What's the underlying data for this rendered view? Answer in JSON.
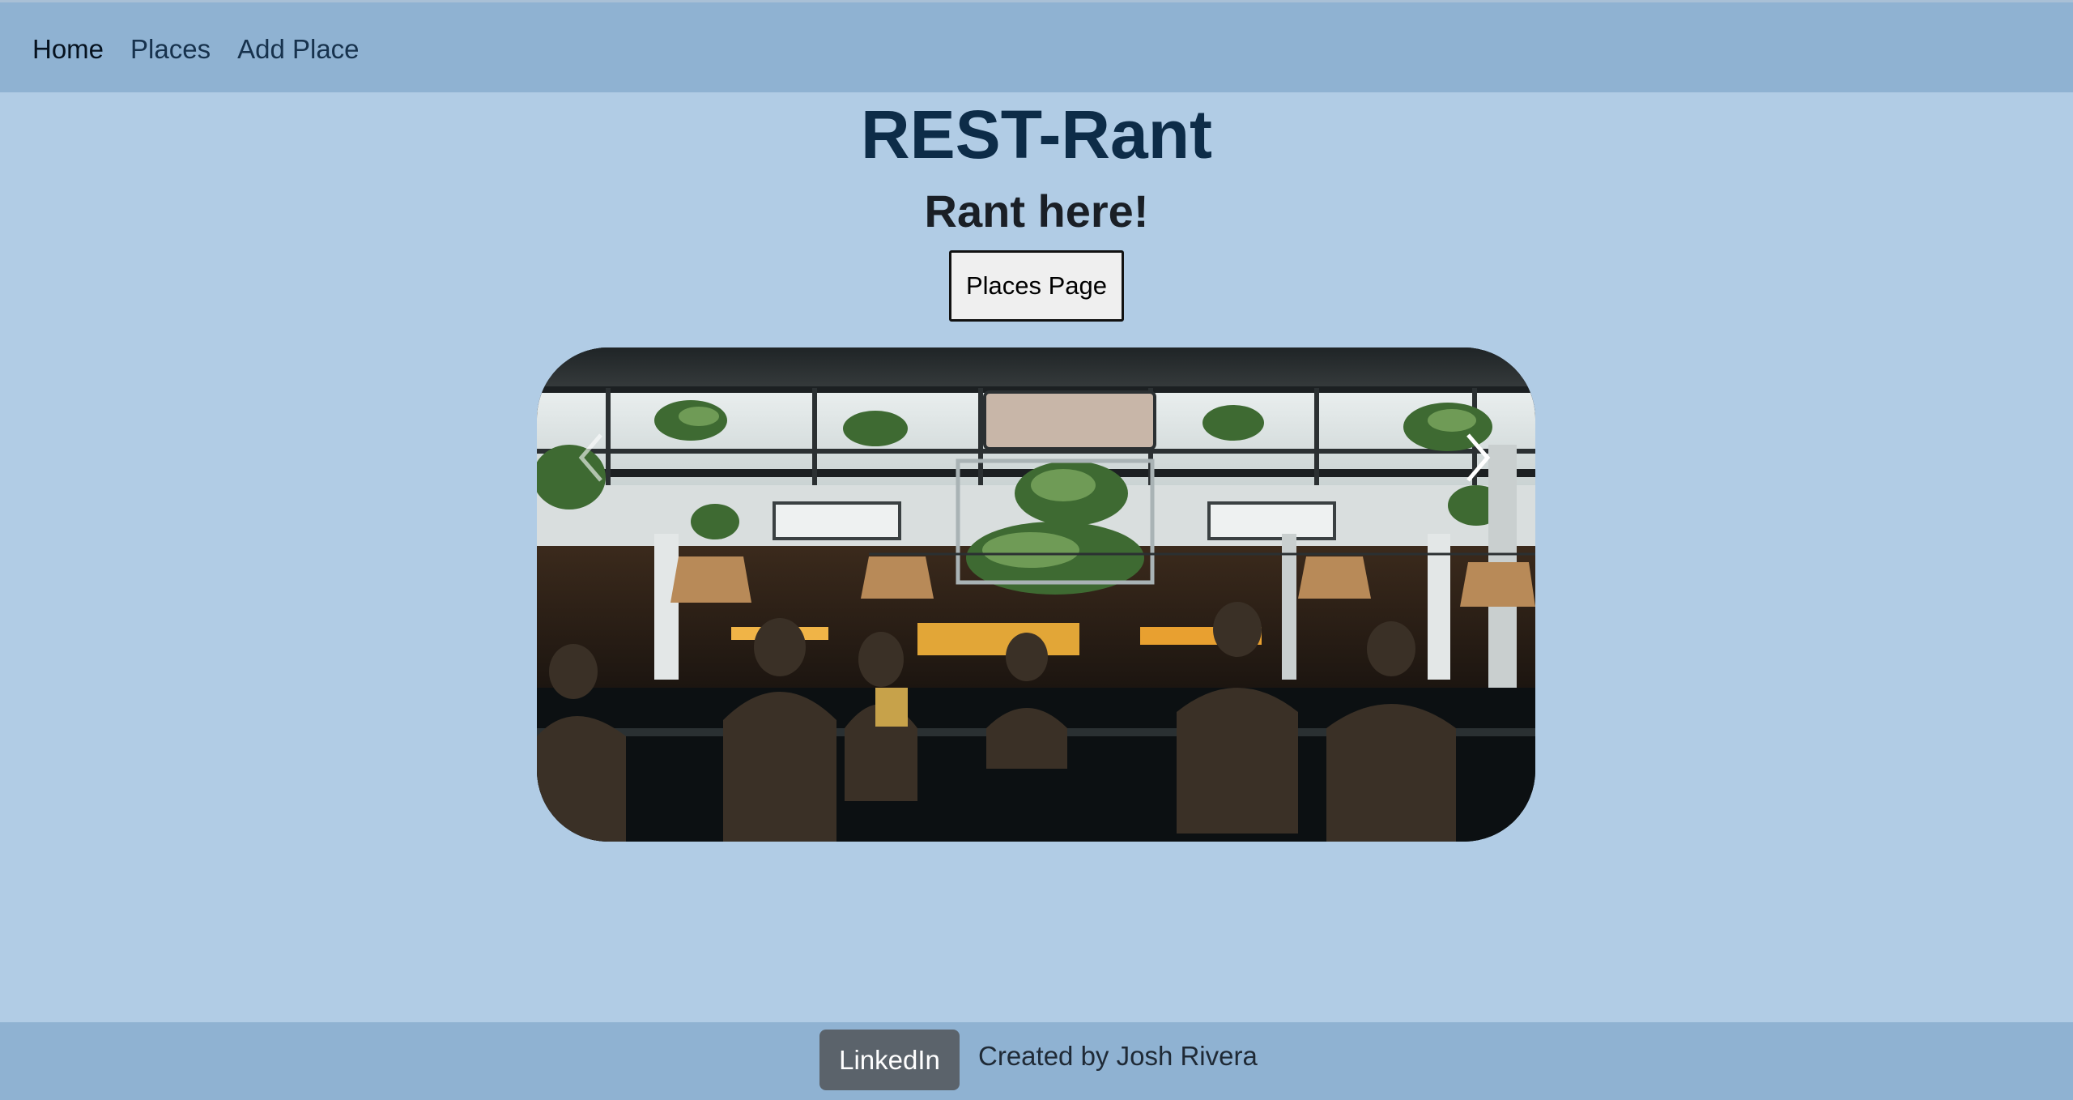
{
  "nav": {
    "items": [
      {
        "label": "Home",
        "active": true
      },
      {
        "label": "Places",
        "active": false
      },
      {
        "label": "Add Place",
        "active": false
      }
    ]
  },
  "hero": {
    "title": "REST-Rant",
    "subtitle": "Rant here!",
    "button_label": "Places Page"
  },
  "carousel": {
    "image_subject": "restaurant bar interior with diners seated at counter",
    "prev_icon": "chevron-left-icon",
    "next_icon": "chevron-right-icon"
  },
  "footer": {
    "linkedin_label": "LinkedIn",
    "credit": "Created by Josh Rivera"
  },
  "colors": {
    "page_bg": "#b1cce5",
    "bar_bg": "#8fb2d2",
    "title": "#0d2c48",
    "linkedin_bg": "#5b636b"
  }
}
